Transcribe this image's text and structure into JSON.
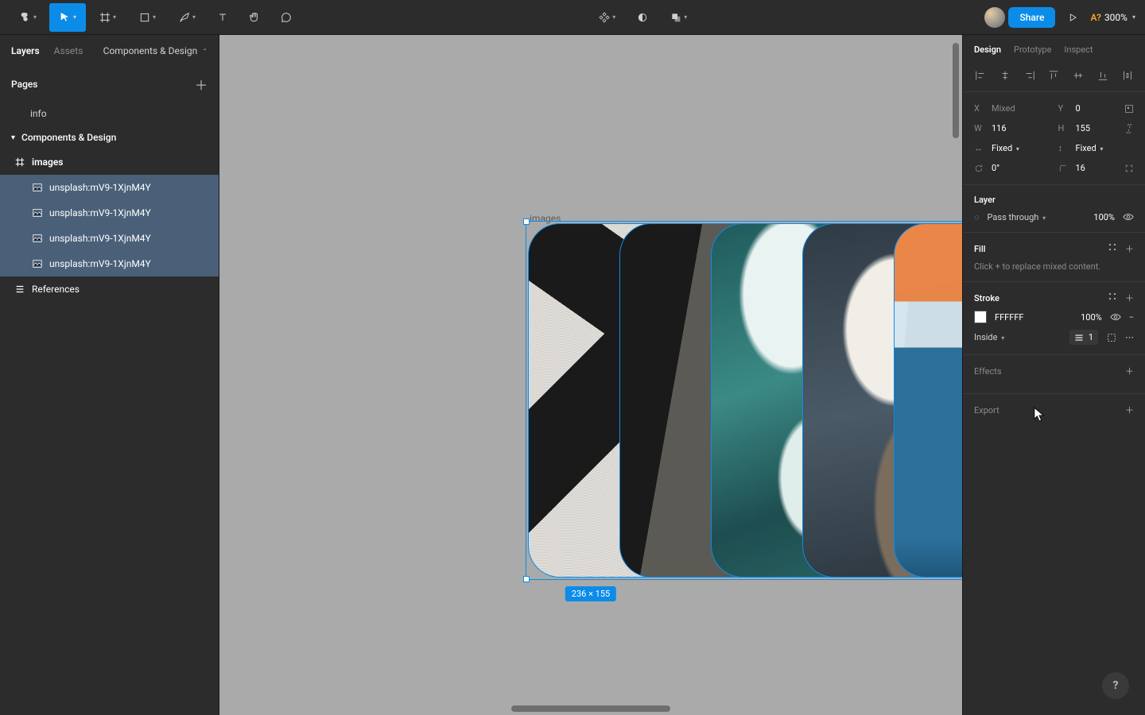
{
  "toolbar": {
    "share_label": "Share",
    "zoom_help": "A?",
    "zoom_value": "300%"
  },
  "left_panel": {
    "tabs": {
      "layers": "Layers",
      "assets": "Assets"
    },
    "nav_label": "Components & Design",
    "pages_label": "Pages",
    "pages": [
      "info"
    ],
    "current_page": "Components & Design",
    "frames": [
      {
        "name": "images",
        "children": [
          "unsplash:mV9-1XjnM4Y",
          "unsplash:mV9-1XjnM4Y",
          "unsplash:mV9-1XjnM4Y",
          "unsplash:mV9-1XjnM4Y"
        ]
      }
    ],
    "refs_label": "References"
  },
  "canvas": {
    "frame_label": "images",
    "dim_badge": "236 × 155"
  },
  "right_panel": {
    "tabs": {
      "design": "Design",
      "prototype": "Prototype",
      "inspect": "Inspect"
    },
    "x_label": "X",
    "x_value": "Mixed",
    "y_label": "Y",
    "y_value": "0",
    "w_label": "W",
    "w_value": "116",
    "h_label": "H",
    "h_value": "155",
    "hmode": "Fixed",
    "vmode": "Fixed",
    "rotation": "0°",
    "radius": "16",
    "layer_title": "Layer",
    "blend_mode": "Pass through",
    "opacity": "100%",
    "fill_title": "Fill",
    "fill_hint": "Click + to replace mixed content.",
    "stroke_title": "Stroke",
    "stroke_color": "FFFFFF",
    "stroke_opacity": "100%",
    "stroke_side": "Inside",
    "stroke_weight": "1",
    "effects_title": "Effects",
    "export_title": "Export"
  },
  "help": "?"
}
